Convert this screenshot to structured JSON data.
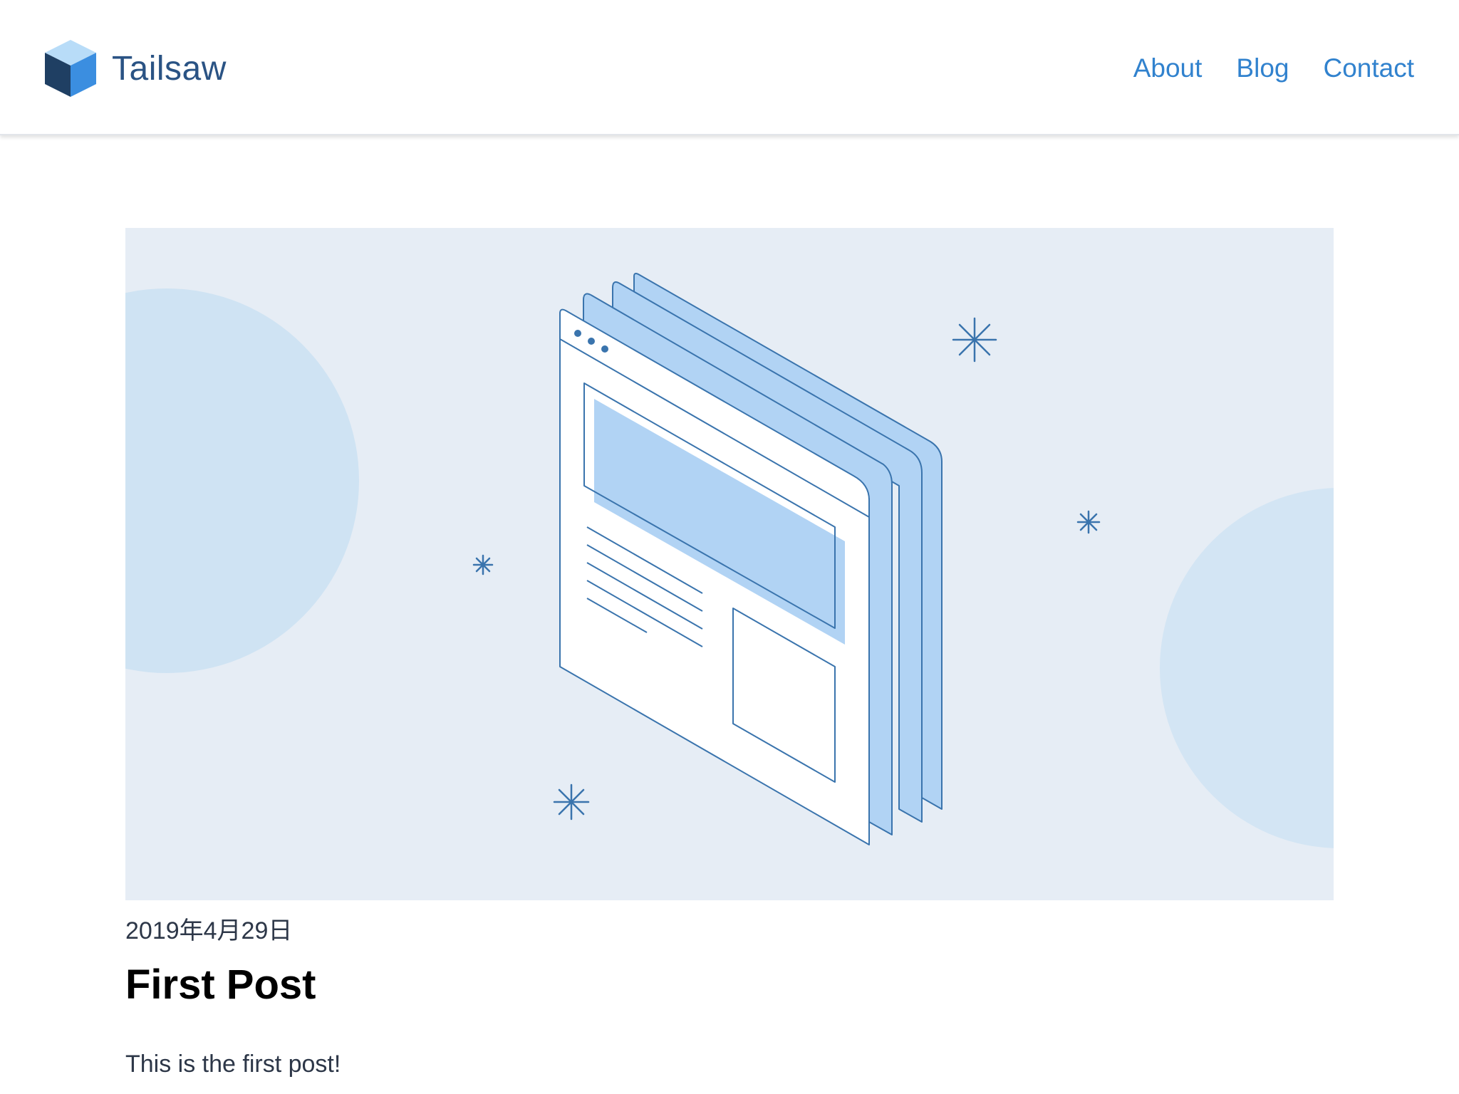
{
  "header": {
    "brand_name": "Tailsaw",
    "brand_icon": "cube-logo-icon",
    "nav": [
      {
        "label": "About"
      },
      {
        "label": "Blog"
      },
      {
        "label": "Contact"
      }
    ]
  },
  "hero": {
    "illustration": "stacked-browser-windows-illustration",
    "colors": {
      "background": "#e6edf5",
      "circle": "#cfe3f3",
      "panel_fill": "#b1d3f4",
      "stroke": "#3a74ad"
    }
  },
  "post": {
    "date": "2019年4月29日",
    "title": "First Post",
    "body": "This is the first post!"
  },
  "colors": {
    "accent": "#3182ce",
    "brand": "#2a5384"
  }
}
